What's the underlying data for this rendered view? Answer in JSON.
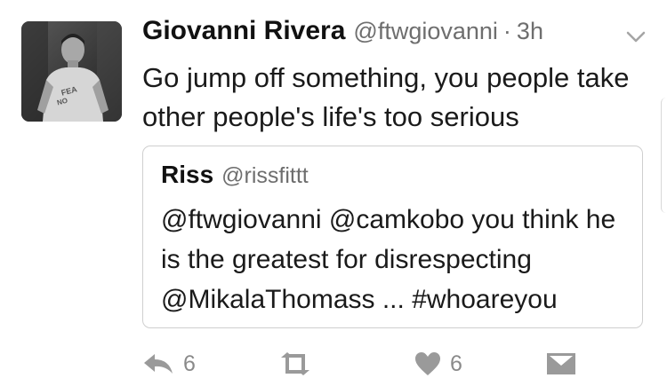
{
  "tweet": {
    "author_name": "Giovanni Rivera",
    "author_handle": "@ftwgiovanni",
    "separator": "·",
    "time": "3h",
    "text": "Go jump off something, you people take other people's life's too serious",
    "avatar_icon": "user-avatar-photo"
  },
  "quoted_tweet": {
    "author_name": "Riss",
    "author_handle": "@rissfittt",
    "text": "@ftwgiovanni @camkobo you think he is the greatest for disrespecting @MikalaThomass ... #whoareyou"
  },
  "actions": {
    "reply_count": "6",
    "like_count": "6",
    "reply_icon": "reply-icon",
    "retweet_icon": "retweet-icon",
    "like_icon": "heart-icon",
    "message_icon": "envelope-icon"
  },
  "colors": {
    "secondary_text": "#6e6e6e",
    "action_icon": "#9a9a9a",
    "quote_border": "#cfcfcf"
  }
}
